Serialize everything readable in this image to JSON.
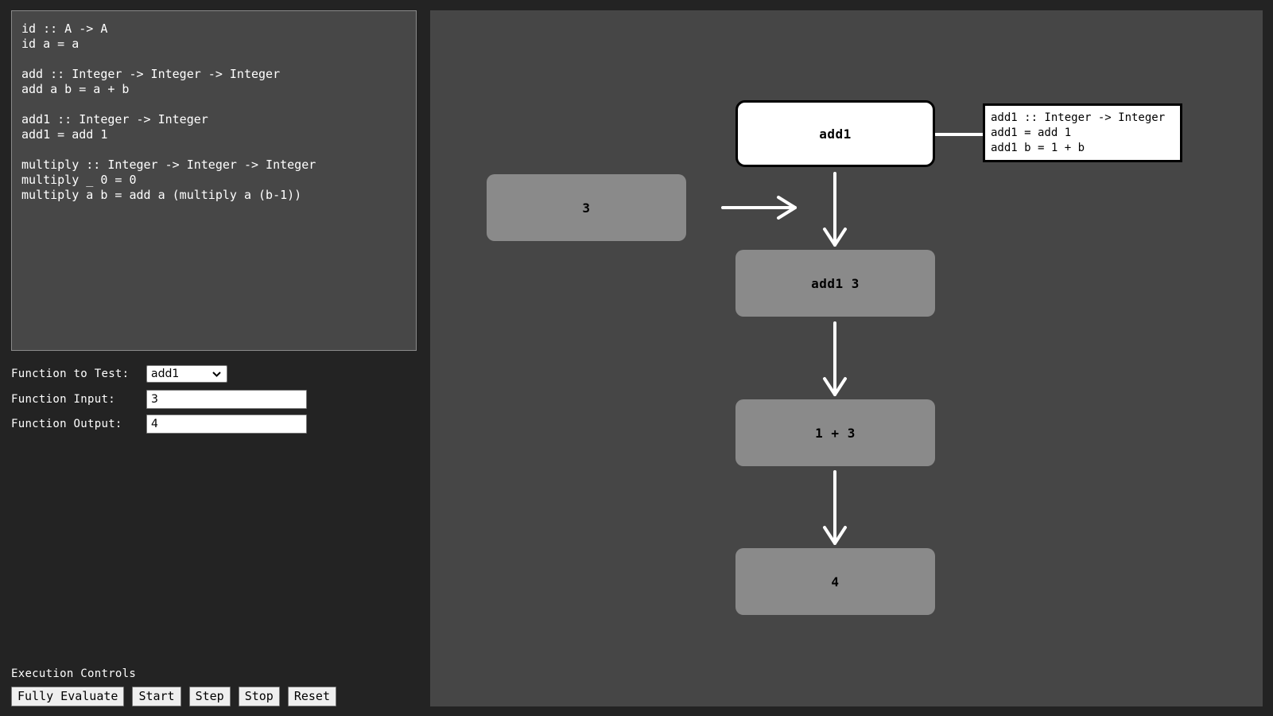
{
  "code_editor": {
    "text": "id :: A -> A\nid a = a\n\nadd :: Integer -> Integer -> Integer\nadd a b = a + b\n\nadd1 :: Integer -> Integer\nadd1 = add 1\n\nmultiply :: Integer -> Integer -> Integer\nmultiply _ 0 = 0\nmultiply a b = add a (multiply a (b-1))"
  },
  "form": {
    "function_label": "Function to Test:",
    "function_selected": "add1",
    "input_label": "Function Input:",
    "input_value": "3",
    "output_label": "Function Output:",
    "output_value": "4"
  },
  "controls": {
    "title": "Execution Controls",
    "fully_evaluate": "Fully Evaluate",
    "start": "Start",
    "step": "Step",
    "stop": "Stop",
    "reset": "Reset"
  },
  "graph": {
    "input_node": "3",
    "function_node": "add1",
    "definition": "add1 :: Integer -> Integer\nadd1 = add 1\nadd1 b = 1 + b",
    "steps": [
      "add1 3",
      "1 + 3",
      "4"
    ]
  },
  "colors": {
    "page_bg": "#232323",
    "panel_bg": "#464646",
    "node_bg": "#8a8a8a",
    "active_node_bg": "#ffffff",
    "arrow": "#ffffff"
  }
}
